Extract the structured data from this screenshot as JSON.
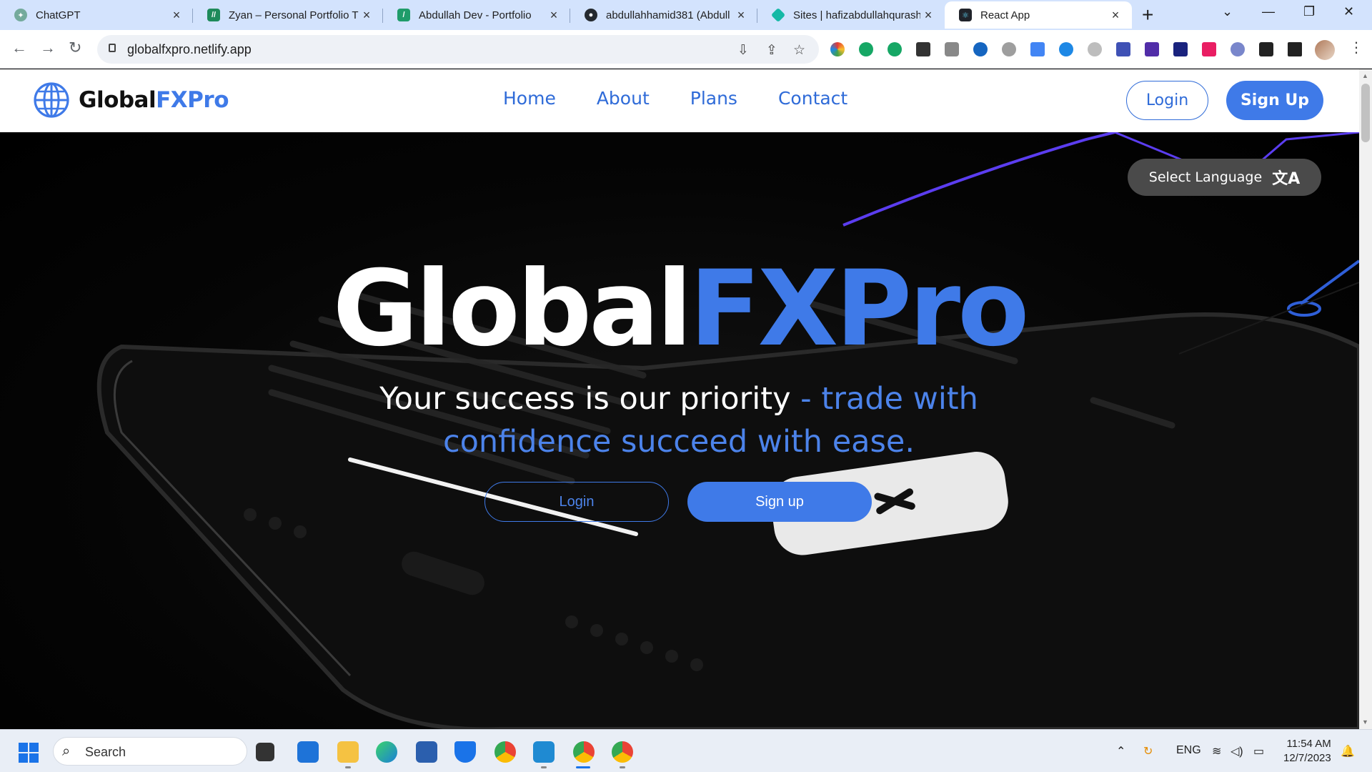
{
  "browser": {
    "tabs": [
      {
        "title": "ChatGPT",
        "icon": "chatgpt-icon",
        "color": "#74aa9c"
      },
      {
        "title": "Zyan – Personal Portfolio T",
        "icon": "zyan-icon",
        "color": "#1e8a5a"
      },
      {
        "title": "Abdullah Dev - Portfolio",
        "icon": "abdullah-dev-icon",
        "color": "#1f9c6a"
      },
      {
        "title": "abdullahhamid381 (Abdull",
        "icon": "github-icon",
        "color": "#24292f"
      },
      {
        "title": "Sites | hafizabdullahqurash",
        "icon": "netlify-icon",
        "color": "#14b8a6"
      },
      {
        "title": "React App",
        "icon": "react-icon",
        "color": "#20232a"
      }
    ],
    "new_tab_label": "+",
    "url": "globalfxpro.netlify.app"
  },
  "site": {
    "logo_part1": "Global",
    "logo_part2": "FXPro",
    "nav": [
      "Home",
      "About",
      "Plans",
      "Contact"
    ],
    "login_label": "Login",
    "signup_label": "Sign Up",
    "select_language": "Select Language",
    "hero": {
      "title_part1": "Global",
      "title_part2": "FXPro",
      "tagline_part1": "Your success is our priority",
      "tagline_part2": " - trade with confidence succeed with ease.",
      "login_label": "Login",
      "signup_label": "Sign up"
    }
  },
  "taskbar": {
    "search_label": "Search",
    "language": "ENG",
    "time": "11:54 AM",
    "date": "12/7/2023"
  },
  "colors": {
    "accent": "#3f7ae8",
    "tabstrip": "#d3e3fd"
  }
}
